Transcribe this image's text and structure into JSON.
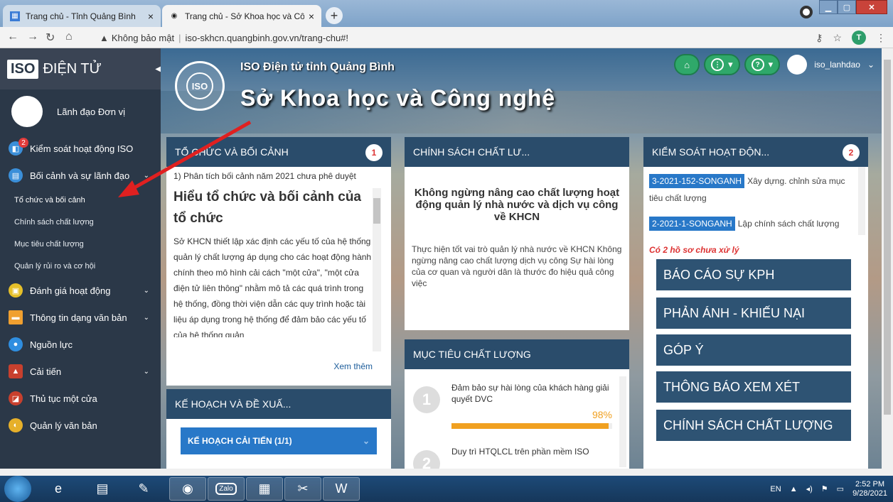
{
  "browser": {
    "tabs": [
      {
        "title": "Trang chủ - Tỉnh Quảng Bình",
        "active": false
      },
      {
        "title": "Trang chủ - Sở Khoa học và Công",
        "active": true
      }
    ],
    "new_tab": "+",
    "security_label": "Không bảo mật",
    "url": "iso-skhcn.quangbinh.gov.vn/trang-chu#!",
    "profile_initial": "T"
  },
  "sidebar": {
    "logo_box": "ISO",
    "logo_text": "ĐIỆN TỬ",
    "user_name": "Lãnh đạo Đơn vị",
    "items": [
      {
        "label": "Kiểm soát hoạt động ISO",
        "icon": "control-icon",
        "badge": "2",
        "color": "#3b8fd9"
      },
      {
        "label": "Bối cảnh và sự lãnh đạo",
        "icon": "context-icon",
        "color": "#3b8fd9"
      },
      {
        "label": "Đánh giá hoạt động",
        "icon": "evaluate-icon",
        "color": "#e6c02a"
      },
      {
        "label": "Thông tin dạng văn bản",
        "icon": "document-icon",
        "color": "#f0a030"
      },
      {
        "label": "Nguồn lực",
        "icon": "people-icon",
        "color": "#2f8ee0"
      },
      {
        "label": "Cải tiến",
        "icon": "improve-icon",
        "color": "#c8402e"
      },
      {
        "label": "Thủ tục một cửa",
        "icon": "onestop-icon",
        "color": "#c8402e"
      },
      {
        "label": "Quản lý văn bản",
        "icon": "archive-icon",
        "color": "#e6b02a"
      }
    ],
    "sub_items": [
      "Tổ chức và bối cảnh",
      "Chính sách chất lượng",
      "Mục tiêu chất lượng",
      "Quản lý rủi ro và cơ hội"
    ]
  },
  "header": {
    "seal_text": "ISO",
    "subtitle": "ISO Điện tử tỉnh Quảng Bình",
    "title": "Sở Khoa học và Công nghệ",
    "user": "iso_lanhdao"
  },
  "panels": {
    "context": {
      "title": "TỔ CHỨC VÀ BỐI CẢNH",
      "count": "1",
      "notice": "1) Phân tích bối cảnh năm 2021 chưa phê duyệt",
      "heading": "Hiểu tổ chức và bối cảnh của tổ chức",
      "body": "Sở KHCN thiết lập xác định các yếu tố của hệ thống quản lý chất lượng áp dụng cho các hoạt động hành chính theo mô hình cải cách \"một cửa\", \"một cửa điện tử liên thông\" nhằm mô tả các quá trình trong hệ thống, đồng thời viện dẫn các quy trình hoặc tài liệu áp dụng trong hệ thống để đảm bảo các yếu tố của hệ thống quản",
      "more": "Xem thêm"
    },
    "policy": {
      "title": "CHÍNH SÁCH CHẤT LƯ...",
      "slogan": "Không ngừng nâng cao chất lượng hoạt động quản lý nhà nước và dịch vụ công về KHCN",
      "desc": "Thực hiện tốt vai trò quản lý nhà nước về KHCN Không ngừng nâng cao chất lượng dịch vụ công Sự hài lòng của cơ quan và người dân là thước đo hiệu quả công việc"
    },
    "goals": {
      "title": "MỤC TIÊU CHẤT LƯỢNG",
      "items": [
        {
          "num": "1",
          "text": "Đảm bảo sự hài lòng của khách hàng giải quyết DVC",
          "percent": "98%",
          "progress": 0.98
        },
        {
          "num": "2",
          "text": "Duy trì HTQLCL trên phần mềm ISO"
        }
      ]
    },
    "activity": {
      "title": "KIỂM SOÁT HOẠT ĐỘN...",
      "count": "2",
      "docs": [
        {
          "code": "3-2021-152-SONGANH",
          "title": "Xây dựng. chỉnh sửa mục tiêu chất lượng"
        },
        {
          "code": "2-2021-1-SONGANH",
          "title": "Lập chính sách chất lượng"
        }
      ],
      "pending": "Có 2 hồ sơ chưa xử lý",
      "buttons": [
        "BÁO CÁO SỰ KPH",
        "PHẢN ÁNH - KHIẾU NẠI",
        "GÓP Ý",
        "THÔNG BÁO XEM XÉT",
        "CHÍNH SÁCH CHẤT LƯỢNG"
      ]
    },
    "plan": {
      "title": "KẾ HOẠCH VÀ ĐỀ XUẤ...",
      "button": "KẾ HOẠCH CẢI TIẾN (1/1)"
    }
  },
  "taskbar": {
    "lang": "EN",
    "time": "2:52 PM",
    "date": "9/28/2021",
    "apps": [
      "ie-icon",
      "explorer-icon",
      "paint-icon",
      "chrome-icon",
      "zalo-icon",
      "media-icon",
      "snipping-icon",
      "word-icon"
    ],
    "zalo_label": "Zalo"
  },
  "colors": {
    "sidebar": "#2b3848",
    "panel_header": "#2a4c6b",
    "action_button": "#2e5373",
    "accent": "#2878c8"
  }
}
